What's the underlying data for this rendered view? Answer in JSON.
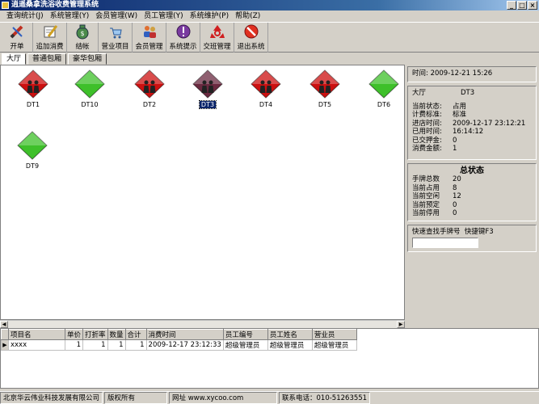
{
  "window": {
    "title": "逍遥桑拿洗浴收费管理系统"
  },
  "menu": [
    "查询统计(J)",
    "系统管理(Y)",
    "会员管理(W)",
    "员工管理(Y)",
    "系统维护(P)",
    "帮助(Z)"
  ],
  "toolbar": [
    {
      "label": "开单",
      "icon": "pencil-icon"
    },
    {
      "label": "追加消费",
      "icon": "notepad-pen-icon"
    },
    {
      "label": "结帐",
      "icon": "money-bag-icon"
    },
    {
      "label": "营业项目",
      "icon": "cart-icon"
    },
    {
      "label": "会员管理",
      "icon": "users-icon"
    },
    {
      "label": "系统提示",
      "icon": "alert-icon"
    },
    {
      "label": "交班管理",
      "icon": "recycle-icon"
    },
    {
      "label": "退出系统",
      "icon": "stop-icon"
    }
  ],
  "tabs": [
    "大厅",
    "普通包厢",
    "豪华包厢"
  ],
  "colors": {
    "occupied": "#cc1010",
    "free": "#3ec02a",
    "selected": "#6a2a40"
  },
  "rooms": [
    {
      "name": "DT1",
      "status": "occupied"
    },
    {
      "name": "DT10",
      "status": "free"
    },
    {
      "name": "DT2",
      "status": "occupied"
    },
    {
      "name": "DT3",
      "status": "selected"
    },
    {
      "name": "DT4",
      "status": "occupied"
    },
    {
      "name": "DT5",
      "status": "occupied"
    },
    {
      "name": "DT6",
      "status": "free"
    },
    {
      "name": "DT9",
      "status": "free"
    }
  ],
  "info": {
    "time_label": "时间:",
    "time_value": "2009-12-21 15:26",
    "hall": "大厅",
    "room": "DT3",
    "rows": [
      {
        "k": "当前状态:",
        "v": "占用"
      },
      {
        "k": "计费标准:",
        "v": "标准"
      },
      {
        "k": "进店时间:",
        "v": "2009-12-17 23:12:21"
      },
      {
        "k": "已用时间:",
        "v": "16:14:12"
      },
      {
        "k": "已交押金:",
        "v": "0"
      },
      {
        "k": "消费金额:",
        "v": "1"
      }
    ]
  },
  "summary": {
    "title": "总状态",
    "rows": [
      {
        "k": "手牌总数",
        "v": "20"
      },
      {
        "k": "当前占用",
        "v": "8"
      },
      {
        "k": "当前空闲",
        "v": "12"
      },
      {
        "k": "当前预定",
        "v": "0"
      },
      {
        "k": "当前停用",
        "v": "0"
      }
    ]
  },
  "quick": {
    "label": "快速查找手牌号",
    "hint": "快捷键F3",
    "value": ""
  },
  "grid": {
    "headers": [
      "项目名",
      "单价",
      "打折率",
      "数量",
      "合计",
      "消费时间",
      "员工编号",
      "员工姓名",
      "营业员"
    ],
    "rows": [
      [
        "xxxx",
        "1",
        "1",
        "1",
        "1",
        "2009-12-17 23:12:33",
        "超级管理员",
        "超级管理员",
        "超级管理员"
      ]
    ]
  },
  "status": [
    "北京华云伟业科技发展有限公司",
    "版权所有",
    "网址 www.xycoo.com",
    "联系电话：010-51263551"
  ]
}
